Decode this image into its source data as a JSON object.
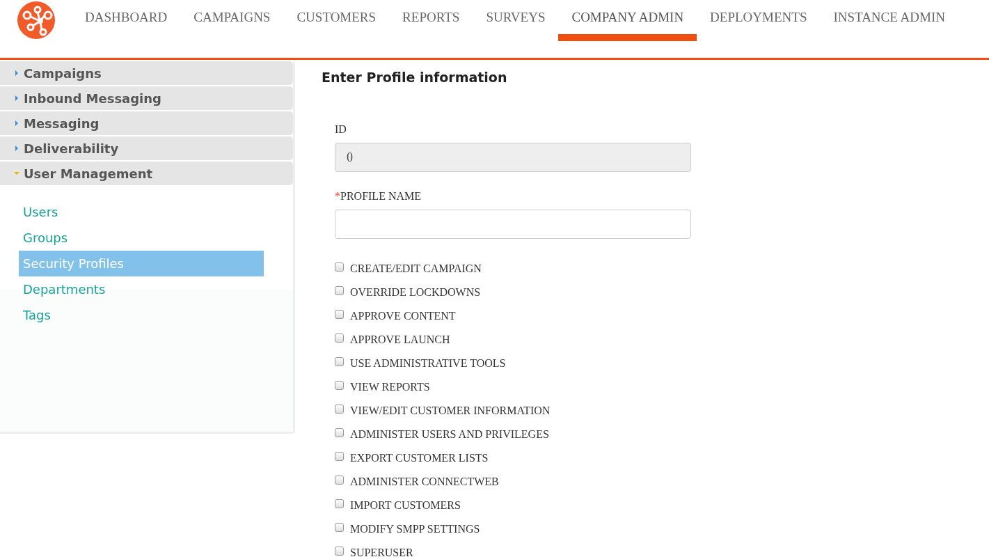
{
  "nav": {
    "tabs": [
      {
        "label": "DASHBOARD",
        "selected": false
      },
      {
        "label": "CAMPAIGNS",
        "selected": false
      },
      {
        "label": "CUSTOMERS",
        "selected": false
      },
      {
        "label": "REPORTS",
        "selected": false
      },
      {
        "label": "SURVEYS",
        "selected": false
      },
      {
        "label": "COMPANY ADMIN",
        "selected": true
      },
      {
        "label": "DEPLOYMENTS",
        "selected": false
      },
      {
        "label": "INSTANCE ADMIN",
        "selected": false
      }
    ]
  },
  "sidebar": {
    "sections": [
      {
        "label": "Campaigns",
        "expanded": false
      },
      {
        "label": "Inbound Messaging",
        "expanded": false
      },
      {
        "label": "Messaging",
        "expanded": false
      },
      {
        "label": "Deliverability",
        "expanded": false
      },
      {
        "label": "User Management",
        "expanded": true,
        "items": [
          {
            "label": "Users",
            "selected": false
          },
          {
            "label": "Groups",
            "selected": false
          },
          {
            "label": "Security Profiles",
            "selected": true
          },
          {
            "label": "Departments",
            "selected": false
          },
          {
            "label": "Tags",
            "selected": false
          }
        ]
      }
    ]
  },
  "form": {
    "title": "Enter Profile information",
    "fields": [
      {
        "label": "ID",
        "value": "0",
        "disabled": true
      },
      {
        "label": "PROFILE NAME",
        "disabled": false,
        "required_mark": "*"
      }
    ],
    "permissions": [
      {
        "label": "CREATE/EDIT CAMPAIGN",
        "checked": false
      },
      {
        "label": "OVERRIDE LOCKDOWNS",
        "checked": false
      },
      {
        "label": "APPROVE CONTENT",
        "checked": false
      },
      {
        "label": "APPROVE LAUNCH",
        "checked": false
      },
      {
        "label": "USE ADMINISTRATIVE TOOLS",
        "checked": false
      },
      {
        "label": "VIEW REPORTS",
        "checked": false
      },
      {
        "label": "VIEW/EDIT CUSTOMER INFORMATION",
        "checked": false
      },
      {
        "label": "ADMINISTER USERS AND PRIVILEGES",
        "checked": false
      },
      {
        "label": "EXPORT CUSTOMER LISTS",
        "checked": false
      },
      {
        "label": "ADMINISTER CONNECTWEB",
        "checked": false
      },
      {
        "label": "IMPORT CUSTOMERS",
        "checked": false
      },
      {
        "label": "MODIFY SMPP SETTINGS",
        "checked": false
      },
      {
        "label": "SUPERUSER",
        "checked": false
      }
    ]
  }
}
